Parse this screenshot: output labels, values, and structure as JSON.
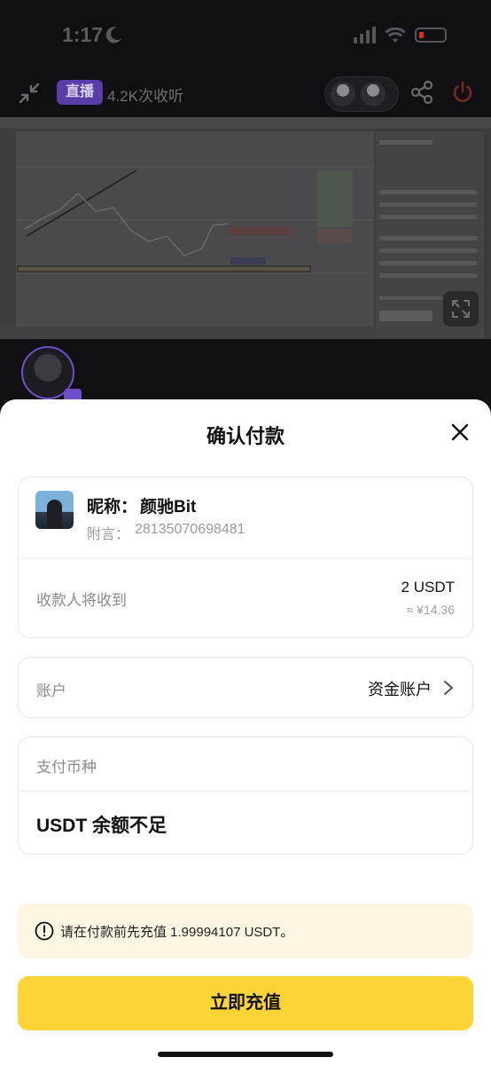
{
  "status_bar": {
    "time": "1:17",
    "battery_color": "#d92b2b"
  },
  "live": {
    "badge": "直播",
    "listeners": "4.2K次收听"
  },
  "sheet": {
    "title": "确认付款",
    "recipient": {
      "nickname_label": "昵称：",
      "nickname": "颜驰Bit",
      "memo_label": "附言：",
      "memo": "28135070698481",
      "receive_label": "收款人将收到",
      "receive_amount": "2 USDT",
      "receive_approx": "≈ ¥14.36"
    },
    "account": {
      "label": "账户",
      "value": "资金账户"
    },
    "currency": {
      "label": "支付币种",
      "value": "USDT 余额不足"
    },
    "notice": "请在付款前先充值 1.99994107 USDT。",
    "primary_button": "立即充值"
  },
  "colors": {
    "accent": "#fdd435",
    "notice_bg": "#fdf6e2",
    "live_badge": "#5b3da8"
  },
  "icons": [
    "collapse-icon",
    "share-icon",
    "power-icon",
    "fullscreen-icon",
    "close-icon",
    "chevron-right-icon",
    "info-icon"
  ]
}
